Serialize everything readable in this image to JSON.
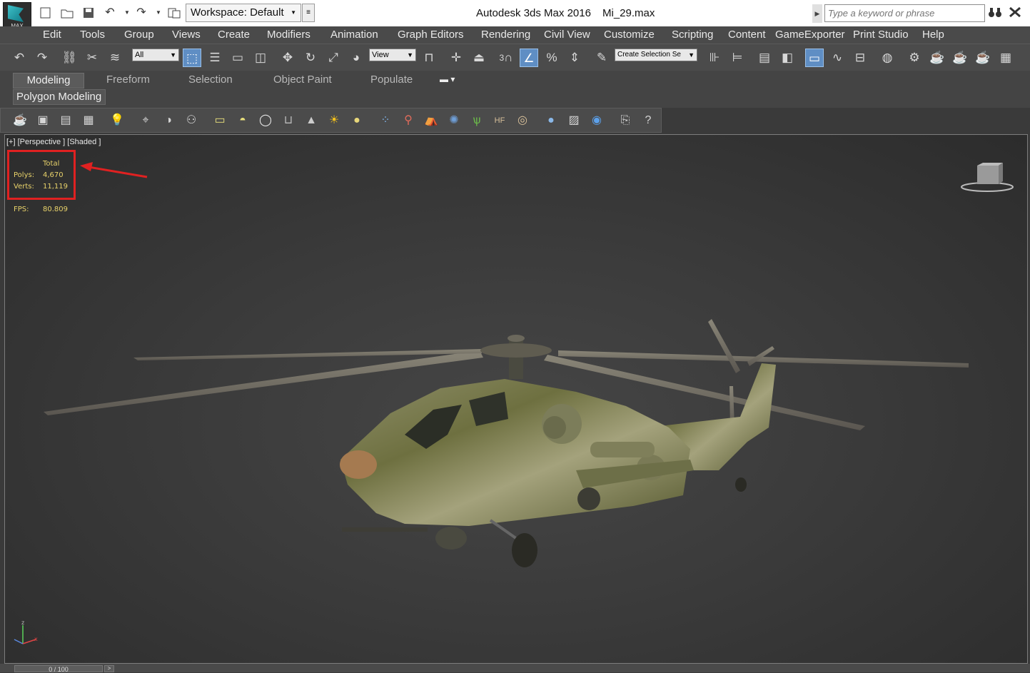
{
  "title_bar": {
    "logo_text": "MAX",
    "workspace_label": "Workspace: Default",
    "app_title": "Autodesk 3ds Max 2016",
    "file_name": "Mi_29.max",
    "search_placeholder": "Type a keyword or phrase"
  },
  "quick_access": [
    "new-file-icon",
    "open-file-icon",
    "save-icon",
    "undo-icon",
    "undo-dropdown-icon",
    "redo-icon",
    "redo-dropdown-icon",
    "project-folder-icon"
  ],
  "menu": [
    "Edit",
    "Tools",
    "Group",
    "Views",
    "Create",
    "Modifiers",
    "Animation",
    "Graph Editors",
    "Rendering",
    "Civil View",
    "Customize",
    "Scripting",
    "Content",
    "GameExporter",
    "Print Studio",
    "Help"
  ],
  "main_toolbar": {
    "selection_filter": "All",
    "reference_coord": "View",
    "named_selection": "Create Selection Se",
    "snap_labels": {
      "angle_snap": "3",
      "percent_snap": "%"
    }
  },
  "ribbon": {
    "tabs": [
      "Modeling",
      "Freeform",
      "Selection",
      "Object Paint",
      "Populate"
    ],
    "active_tab": "Modeling",
    "panel": "Polygon Modeling"
  },
  "viewport": {
    "label": "[+] [Perspective ] [Shaded ]",
    "stats": {
      "header": "Total",
      "polys_label": "Polys:",
      "polys_value": "4,670",
      "verts_label": "Verts:",
      "verts_value": "11,119",
      "fps_label": "FPS:",
      "fps_value": "80.809"
    },
    "annotation_color": "#e02121",
    "stats_color": "#e8d26a"
  },
  "timeline": {
    "frame_display": "0 / 100",
    "next_label": ">"
  }
}
